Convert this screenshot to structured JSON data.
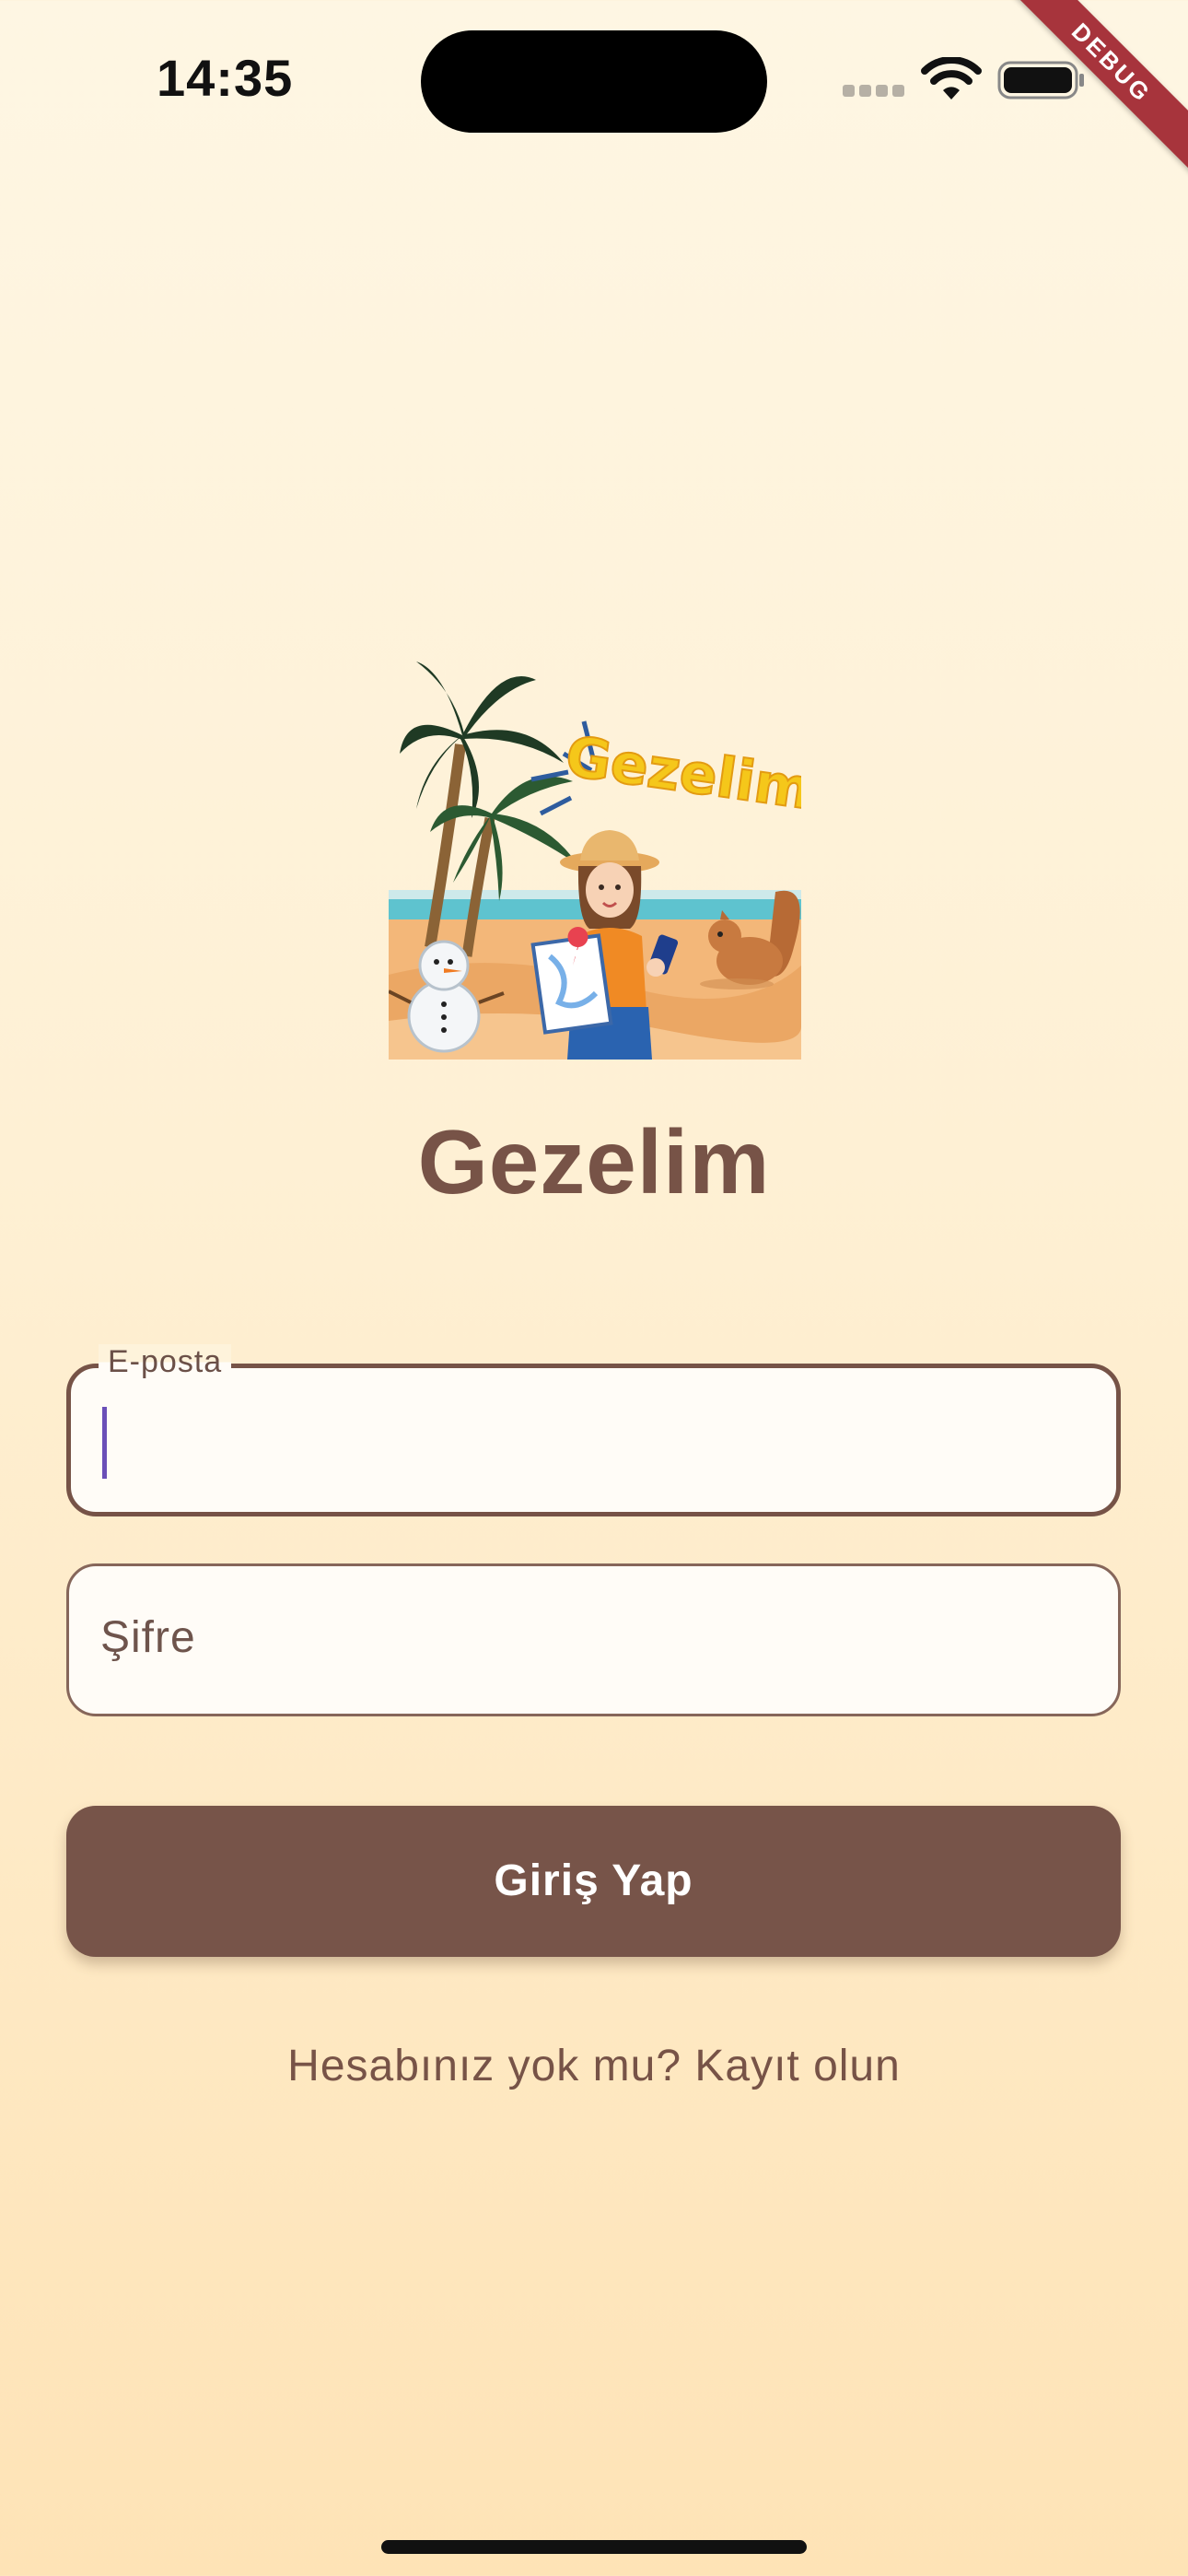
{
  "status_bar": {
    "time": "14:35"
  },
  "debug_banner": {
    "label": "DEBUG"
  },
  "logo": {
    "text": "Gezelim",
    "icon": "travel-logo-illustration"
  },
  "app": {
    "title": "Gezelim"
  },
  "form": {
    "email": {
      "label": "E-posta",
      "value": ""
    },
    "password": {
      "placeholder": "Şifre",
      "value": ""
    },
    "login_button_label": "Giriş Yap",
    "register_link_label": "Hesabınız yok mu? Kayıt olun"
  },
  "colors": {
    "primary": "#775449",
    "background_top": "#FEF6E3",
    "background_bottom": "#FEE3B6",
    "field_background": "#FFFCF7",
    "caret": "#6A4FB8",
    "debug_banner": "#A7343C"
  }
}
